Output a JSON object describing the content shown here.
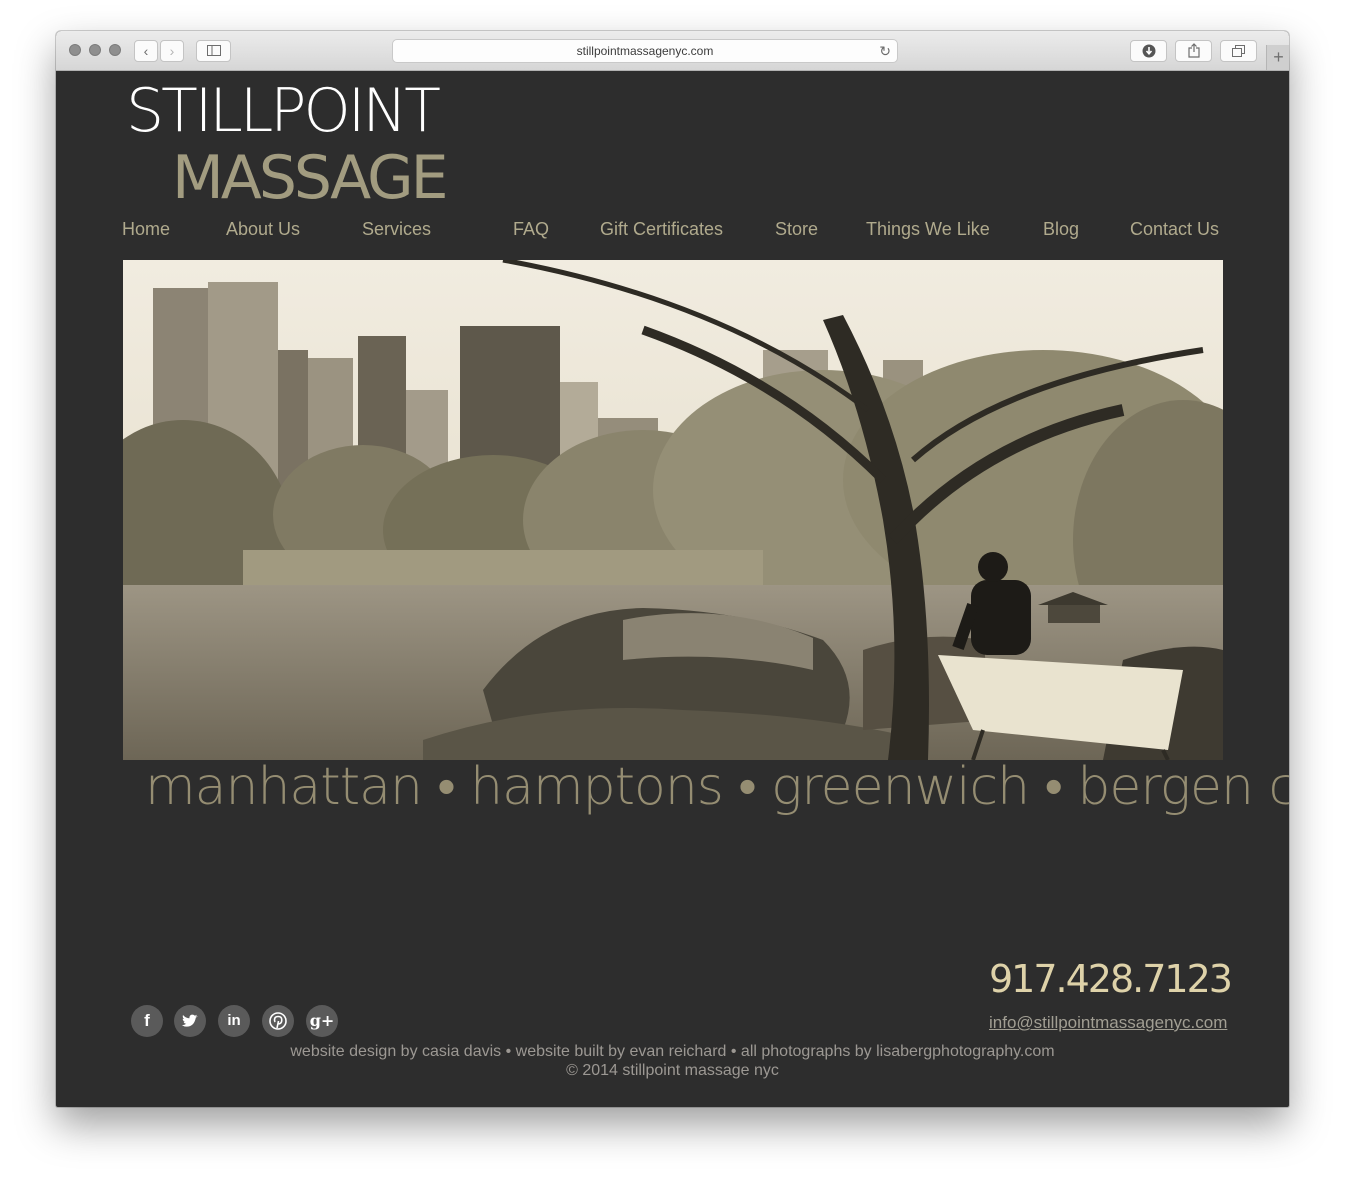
{
  "browser": {
    "url": "stillpointmassagenyc.com"
  },
  "logo": {
    "line1": "STILLPOINT",
    "line2": "MASSAGE"
  },
  "nav": {
    "items": [
      "Home",
      "About Us",
      "Services",
      "FAQ",
      "Gift Certificates",
      "Store",
      "Things We Like",
      "Blog",
      "Contact Us"
    ]
  },
  "tagline": "manhattan • hamptons • greenwich • bergen co",
  "contact": {
    "phone": "917.428.7123",
    "email": "info@stillpointmassagenyc.com"
  },
  "social": {
    "icons": [
      "facebook-icon",
      "twitter-icon",
      "linkedin-icon",
      "pinterest-icon",
      "google-plus-icon"
    ],
    "labels": [
      "f",
      "",
      "in",
      "",
      "g+"
    ]
  },
  "footer": {
    "credits": "website design by casia davis • website built by evan reichard • all photographs by lisabergphotography.com",
    "copyright": "© 2014 stillpoint massage nyc"
  },
  "colors": {
    "page_bg": "#2d2d2d",
    "nav_text": "#b0aa8d",
    "logo_accent": "#a29c80",
    "tagline": "#958d72",
    "phone": "#ded2a9"
  }
}
